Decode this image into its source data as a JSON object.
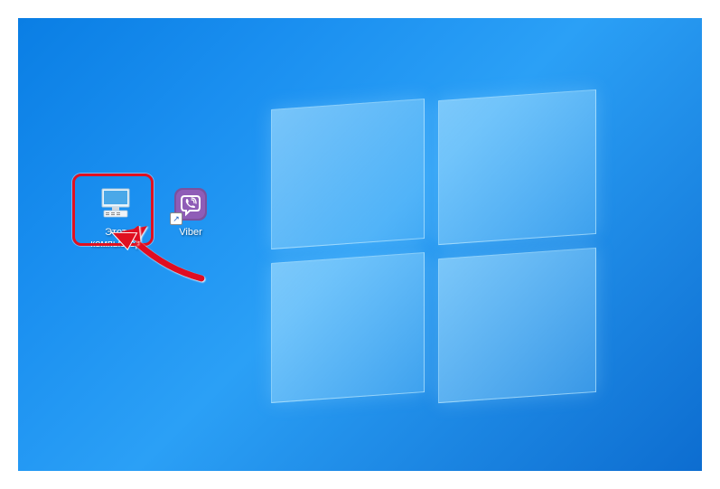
{
  "desktop": {
    "icons": {
      "this_pc": {
        "label": "Этот компьютер",
        "name": "this-pc-icon"
      },
      "viber": {
        "label": "Viber",
        "name": "viber-icon"
      }
    }
  },
  "annotation": {
    "highlight_target": "this-pc-icon",
    "highlight_color": "#e01020"
  }
}
